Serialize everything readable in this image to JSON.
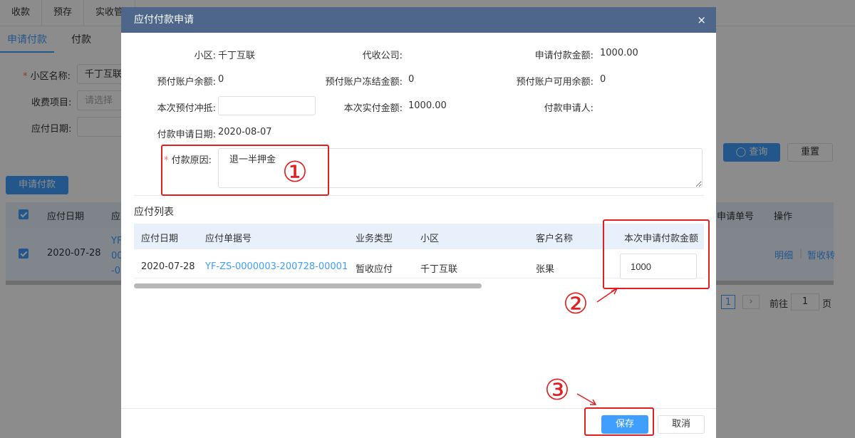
{
  "background": {
    "top_tabs": [
      "收款",
      "预存",
      "实收管"
    ],
    "sub_tabs": [
      "申请付款",
      "付款"
    ],
    "filters": {
      "community_label": "小区名称:",
      "community_value": "千丁互联",
      "fee_item_label": "收费项目:",
      "fee_item_placeholder": "请选择",
      "date_label": "应付日期:"
    },
    "query_button": "查询",
    "reset_button": "重置",
    "apply_button": "申请付款",
    "table": {
      "col_date": "应付日期",
      "col_doc": "应",
      "col_apply_no": "申请单号",
      "col_ops": "操作",
      "row_date": "2020-07-28",
      "row_doc_lines": [
        "YF",
        "00",
        "-0"
      ],
      "detail_link": "明细",
      "temp_link": "暂收转"
    },
    "pagination": {
      "page": "1",
      "goto_label": "前往",
      "goto_value": "1",
      "page_unit": "页"
    }
  },
  "modal": {
    "title": "应付付款申请",
    "close_icon": "×",
    "fields": {
      "community_label": "小区:",
      "community_value": "千丁互联",
      "collector_label": "代收公司:",
      "collector_value": "",
      "apply_amount_label": "申请付款金额:",
      "apply_amount_value": "1000.00",
      "prepaid_balance_label": "预付账户余额:",
      "prepaid_balance_value": "0",
      "prepaid_frozen_label": "预付账户冻结金额:",
      "prepaid_frozen_value": "0",
      "prepaid_available_label": "预付账户可用余额:",
      "prepaid_available_value": "0",
      "offset_label": "本次预付冲抵:",
      "offset_value": "",
      "actual_amount_label": "本次实付金额:",
      "actual_amount_value": "1000.00",
      "applicant_label": "付款申请人:",
      "applicant_value": "",
      "apply_date_label": "付款申请日期:",
      "apply_date_value": "2020-08-07",
      "reason_required": "*",
      "reason_label": "付款原因:",
      "reason_value": "退一半押金"
    },
    "list_title": "应付列表",
    "table": {
      "headers": [
        "应付日期",
        "应付单据号",
        "业务类型",
        "小区",
        "客户名称",
        "本次申请付款金额"
      ],
      "row": {
        "date": "2020-07-28",
        "doc_no": "YF-ZS-0000003-200728-00001",
        "biz_type": "暂收应付",
        "community": "千丁互联",
        "customer": "张果",
        "amount": "1000"
      }
    },
    "save_button": "保存",
    "cancel_button": "取消"
  },
  "annotations": {
    "step1": "①",
    "step2": "②",
    "step3": "③"
  },
  "colors": {
    "accent": "#409eff",
    "header": "#4d6689",
    "annotation": "#e02020"
  }
}
